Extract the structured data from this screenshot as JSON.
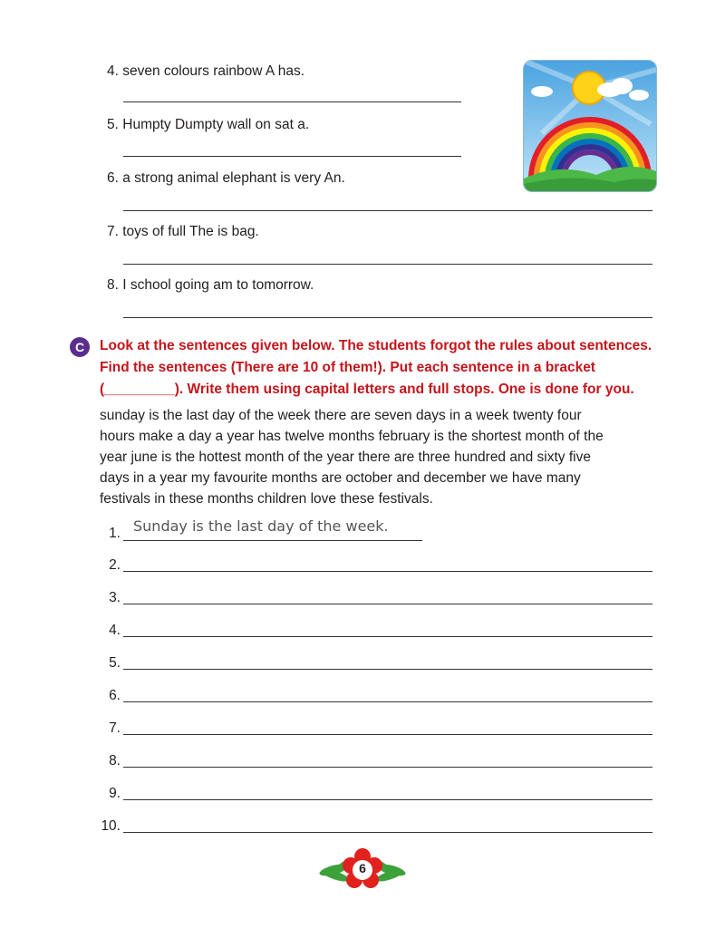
{
  "questions_top": [
    {
      "number": "4.",
      "text": "seven colours rainbow A has."
    },
    {
      "number": "5.",
      "text": "Humpty Dumpty wall on sat a."
    },
    {
      "number": "6.",
      "text": "a strong animal elephant is very An."
    },
    {
      "number": "7.",
      "text": "toys of full The is bag."
    },
    {
      "number": "8.",
      "text": "I school going am to tomorrow."
    }
  ],
  "section_c": {
    "badge": "C",
    "instruction_lines": [
      "Look at the sentences given below. The students forgot the rules about sentences.",
      "Find the sentences (There are 10 of them!). Put each sentence in a bracket",
      "(_________). Write them using capital letters and full stops. One is done for you."
    ],
    "paragraph_lines": [
      "sunday is the last day of the week there are seven days in a week twenty four",
      "hours make a day a year has twelve months february is the shortest month of the",
      "year june is the hottest month of the year there are three hundred and sixty five",
      "days in a year my favourite months are october and december we have many",
      "festivals in these months children love these festivals."
    ],
    "example_answer": "Sunday is the last day of the week.",
    "answer_numbers": [
      "1.",
      "2.",
      "3.",
      "4.",
      "5.",
      "6.",
      "7.",
      "8.",
      "9.",
      "10."
    ]
  },
  "page_number": "6",
  "colors": {
    "instruction": "#c4161c",
    "badge": "#5b2d8e"
  },
  "icons": [
    "rainbow-illustration",
    "flower-page-badge"
  ]
}
